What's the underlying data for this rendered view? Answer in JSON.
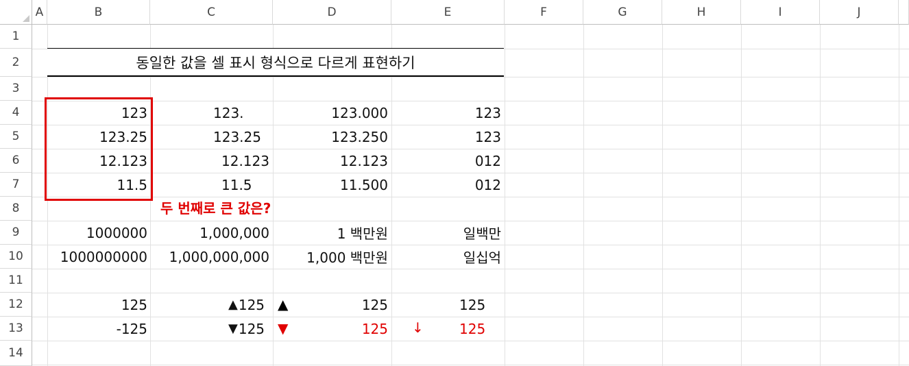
{
  "columns": [
    "A",
    "B",
    "C",
    "D",
    "E",
    "F",
    "G",
    "H",
    "I",
    "J"
  ],
  "rows": [
    "1",
    "2",
    "3",
    "4",
    "5",
    "6",
    "7",
    "8",
    "9",
    "10",
    "11",
    "12",
    "13",
    "14"
  ],
  "title": "동일한 값을 셀 표시 형식으로 다르게 표현하기",
  "note": "두 번째로 큰 값은?",
  "colors": {
    "accent_red": "#e00000",
    "text": "#111111",
    "grid": "#e1e1e1"
  },
  "cells": {
    "B4": "123",
    "C4": "123.",
    "D4": "123.000",
    "E4": "123",
    "B5": "123.25",
    "C5": "123.25",
    "D5": "123.250",
    "E5": "123",
    "B6": "12.123",
    "C6": "12.123",
    "D6": "12.123",
    "E6": "012",
    "B7": "11.5",
    "C7": "11.5",
    "D7": "11.500",
    "E7": "012",
    "B9": "1000000",
    "C9": "1,000,000",
    "D9": "1 백만원",
    "E9": "일백만",
    "B10": "1000000000",
    "C10": "1,000,000,000",
    "D10": "1,000 백만원",
    "E10": "일십억",
    "B12": "125",
    "C12": "125",
    "D12": "125",
    "E12": "125",
    "B13": "-125",
    "C13": "125",
    "D13": "125",
    "E13": "125"
  },
  "symbols": {
    "up_triangle": "▲",
    "down_triangle": "▼",
    "down_arrow": "↓"
  }
}
